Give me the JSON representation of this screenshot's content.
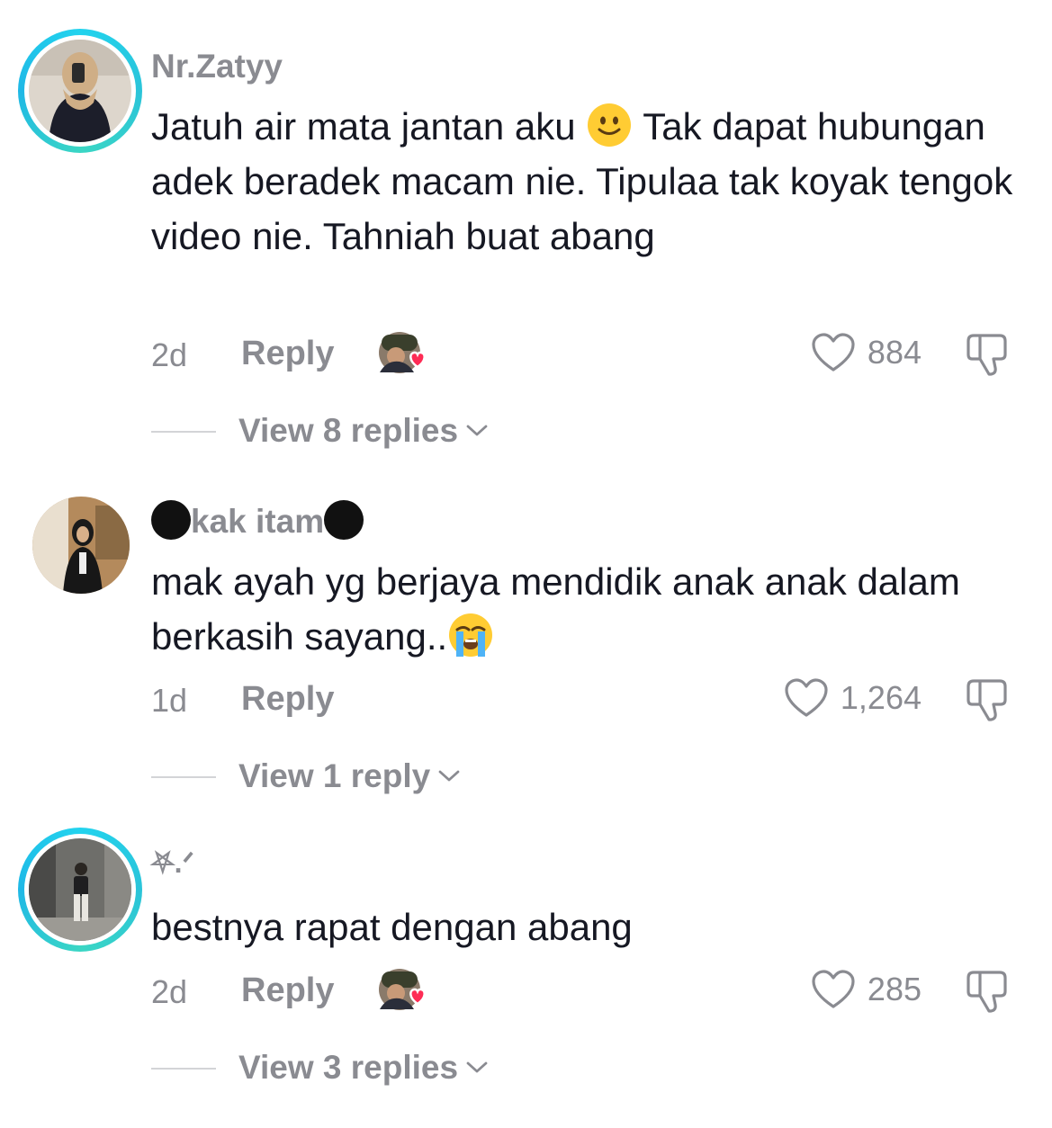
{
  "comments": [
    {
      "username": "Nr.Zatyy",
      "text_before_emoji": "Jatuh air mata jantan aku ",
      "emoji": "slightly-smiling-face",
      "text_after_emoji": " Tak dapat hubungan adek beradek macam nie. Tipulaa tak koyak tengok video nie. Tahniah buat abang",
      "time": "2d",
      "reply_label": "Reply",
      "creator_liked": true,
      "likes": "884",
      "view_replies": "View 8 replies"
    },
    {
      "username": "kak itam",
      "text_before_emoji": "mak ayah yg berjaya mendidik anak anak dalam berkasih sayang..",
      "emoji": "loudly-crying-face",
      "text_after_emoji": "",
      "time": "1d",
      "reply_label": "Reply",
      "creator_liked": false,
      "likes": "1,264",
      "view_replies": "View 1 reply"
    },
    {
      "username": "⛧.ᐟ",
      "text_before_emoji": "bestnya rapat dengan abang",
      "emoji": "",
      "text_after_emoji": "",
      "time": "2d",
      "reply_label": "Reply",
      "creator_liked": true,
      "likes": "285",
      "view_replies": "View 3 replies"
    }
  ],
  "colors": {
    "ring": "#22d3ee",
    "muted": "#8a8b91",
    "text": "#161823",
    "heart_red": "#fe2c55"
  }
}
